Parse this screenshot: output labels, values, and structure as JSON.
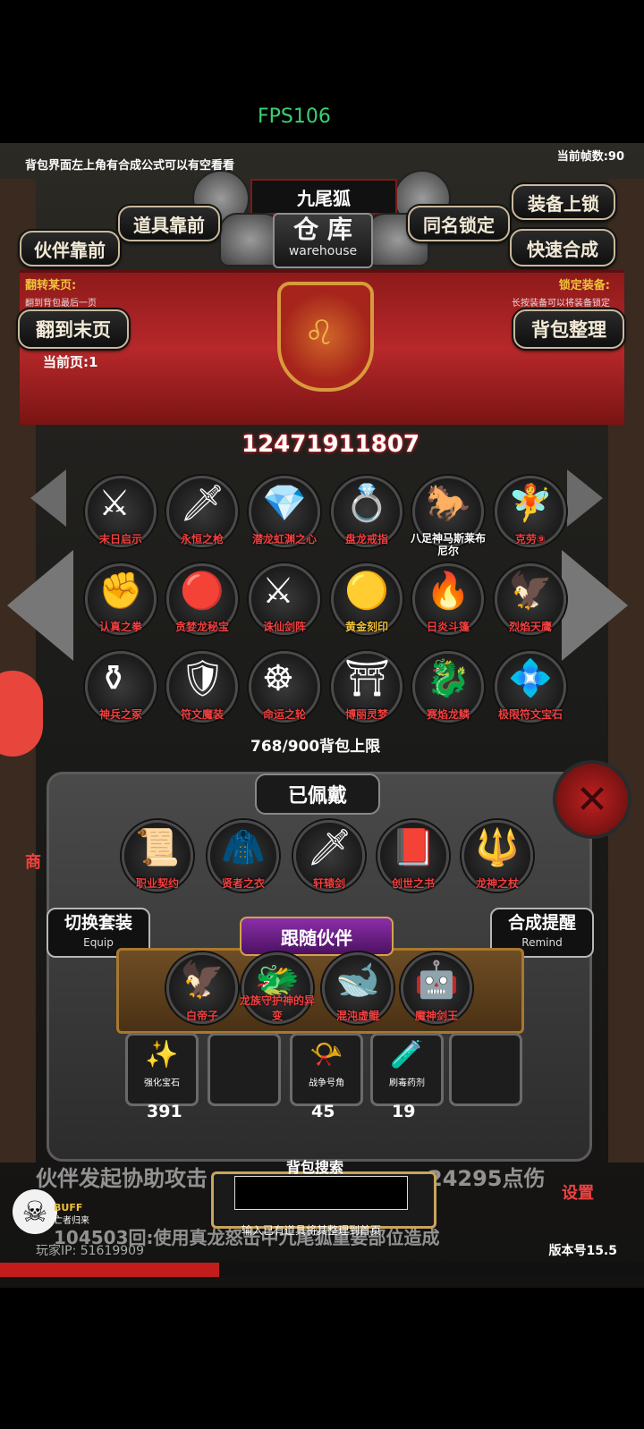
{
  "overlay": {
    "fps": "FPS106"
  },
  "top": {
    "hint": "背包界面左上角有合成公式可以有空看看",
    "frame_rate": "当前帧数:90",
    "pet_name": "九尾狐",
    "warehouse_cn": "仓 库",
    "warehouse_en": "warehouse"
  },
  "buttons": {
    "items_front": "道具靠前",
    "companion_front": "伙伴靠前",
    "same_name_lock": "同名锁定",
    "equip_lock": "装备上锁",
    "quick_merge": "快速合成",
    "last_page": "翻到末页",
    "sort_bag": "背包整理"
  },
  "hints": {
    "flip_label": "翻转某页:",
    "flip_hint": "翻到背包最后一页",
    "lock_label": "锁定装备:",
    "lock_hint": "长按装备可以将装备锁定",
    "current_page": "当前页:1"
  },
  "gold": "12471911807",
  "items": [
    {
      "label": "末日启示",
      "icon": "⚔"
    },
    {
      "label": "永恒之枪",
      "icon": "🗡"
    },
    {
      "label": "潜龙虹渊之心",
      "icon": "💎"
    },
    {
      "label": "盘龙戒指",
      "icon": "💍"
    },
    {
      "label": "八足神马斯莱布尼尔",
      "icon": "🐎"
    },
    {
      "label": "克劳⑨",
      "icon": "🧚"
    },
    {
      "label": "认真之拳",
      "icon": "✊"
    },
    {
      "label": "贪婪龙秘宝",
      "icon": "🔴"
    },
    {
      "label": "诛仙剑阵",
      "icon": "⚔"
    },
    {
      "label": "黄金刻印",
      "icon": "🟡"
    },
    {
      "label": "日炎斗篷",
      "icon": "🔥"
    },
    {
      "label": "烈焰天鹰",
      "icon": "🦅"
    },
    {
      "label": "神兵之冢",
      "icon": "⚱"
    },
    {
      "label": "符文魔装",
      "icon": "🛡"
    },
    {
      "label": "命运之轮",
      "icon": "☸"
    },
    {
      "label": "博丽灵梦",
      "icon": "⛩"
    },
    {
      "label": "赛焰龙鳞",
      "icon": "🐉"
    },
    {
      "label": "极限符文宝石",
      "icon": "💠"
    }
  ],
  "capacity": "768/900背包上限",
  "equipped": {
    "title": "已佩戴",
    "items": [
      {
        "label": "职业契约",
        "icon": "📜"
      },
      {
        "label": "贤者之衣",
        "icon": "🧥"
      },
      {
        "label": "轩辕剑",
        "icon": "🗡"
      },
      {
        "label": "创世之书",
        "icon": "📕"
      },
      {
        "label": "龙神之杖",
        "icon": "🔱"
      }
    ]
  },
  "switch_set": {
    "cn": "切换套装",
    "en": "Equip"
  },
  "merge_remind": {
    "cn": "合成提醒",
    "en": "Remind"
  },
  "follow": {
    "title": "跟随伙伴",
    "companions": [
      {
        "label": "白帝子",
        "icon": "🦅"
      },
      {
        "label": "龙族守护神的异变",
        "icon": "🐲"
      },
      {
        "label": "混沌虚鲲",
        "icon": "🐋"
      },
      {
        "label": "魔神剑王",
        "icon": "🤖"
      }
    ]
  },
  "inventory": [
    {
      "name": "强化宝石",
      "count": "391",
      "icon": "✨"
    },
    {
      "name": "",
      "count": "",
      "icon": ""
    },
    {
      "name": "战争号角",
      "count": "45",
      "icon": "📯"
    },
    {
      "name": "刷毒药剂",
      "count": "19",
      "icon": "🧪"
    },
    {
      "name": "",
      "count": "",
      "icon": ""
    }
  ],
  "scroll": {
    "line1_left": "伙伴发起协助攻击",
    "line1_right": "24295点伤",
    "line2": "104503回:使用真龙怒击中九尾狐重要部位造成"
  },
  "search": {
    "title": "背包搜索",
    "value": "",
    "hint": "输入已有道具将其整理到首页"
  },
  "side": {
    "shop": "商",
    "settings": "设置",
    "buff": "BUFF",
    "buff_sub": "亡者归来"
  },
  "footer": {
    "ip": "玩家IP: 51619909",
    "version": "版本号15.5"
  },
  "progress": 0.34
}
